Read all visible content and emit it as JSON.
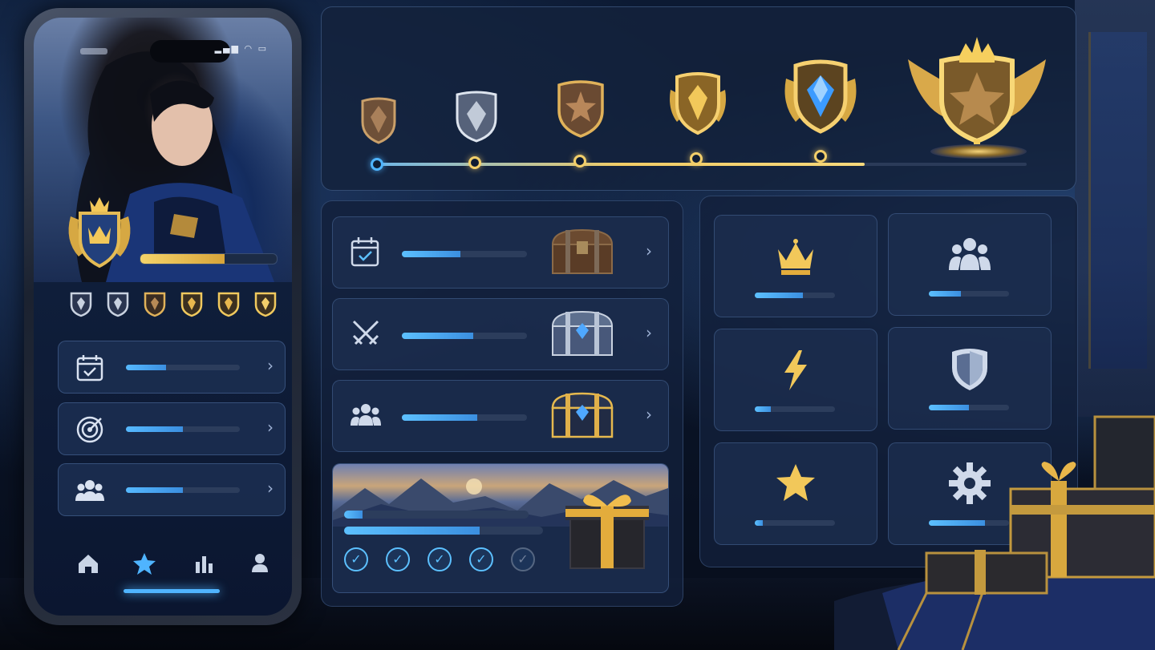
{
  "theme": {
    "accent": "#4fb4ff",
    "gold": "#f3cf6a",
    "panel": "#14223c"
  },
  "phone": {
    "status_icons": "▂▄▆ ◠ ▭",
    "rank_progress": 0.62,
    "mini_tiers": [
      "silver-shield-icon",
      "silver-shield-icon",
      "bronze-shield-icon",
      "gold-shield-icon",
      "gold-shield-icon",
      "gold-shield-icon"
    ],
    "rows": [
      {
        "icon": "calendar-check-icon",
        "progress": 0.35
      },
      {
        "icon": "target-icon",
        "progress": 0.5
      },
      {
        "icon": "group-icon",
        "progress": 0.5
      }
    ],
    "tabs": [
      {
        "icon": "home-icon",
        "active": false
      },
      {
        "icon": "star-icon",
        "active": true
      },
      {
        "icon": "bar-chart-icon",
        "active": false
      },
      {
        "icon": "profile-icon",
        "active": false
      }
    ]
  },
  "progression": {
    "tiers": [
      "bronze-shield-icon",
      "silver-shield-icon",
      "bronze-star-shield-icon",
      "gold-shield-icon",
      "sapphire-shield-icon",
      "winged-crown-shield-icon"
    ],
    "track_progress": 0.75,
    "current_node": 1
  },
  "tasks": {
    "rows": [
      {
        "icon": "calendar-check-icon",
        "progress": 0.47,
        "reward": "wooden-chest-icon"
      },
      {
        "icon": "crossed-swords-icon",
        "progress": 0.57,
        "reward": "silver-chest-icon"
      },
      {
        "icon": "group-icon",
        "progress": 0.6,
        "reward": "gold-chest-icon"
      }
    ],
    "event": {
      "progress_top": 0.1,
      "progress_bottom": 0.68,
      "checks": [
        true,
        true,
        true,
        true,
        false
      ],
      "reward": "gift-box-icon"
    }
  },
  "categories": [
    {
      "icon": "crown-icon",
      "progress": 0.6
    },
    {
      "icon": "group-icon",
      "progress": 0.4
    },
    {
      "icon": "lightning-icon",
      "progress": 0.2
    },
    {
      "icon": "shield-icon",
      "progress": 0.5
    },
    {
      "icon": "star-icon",
      "progress": 0.1
    },
    {
      "icon": "gear-icon",
      "progress": 0.7
    }
  ]
}
